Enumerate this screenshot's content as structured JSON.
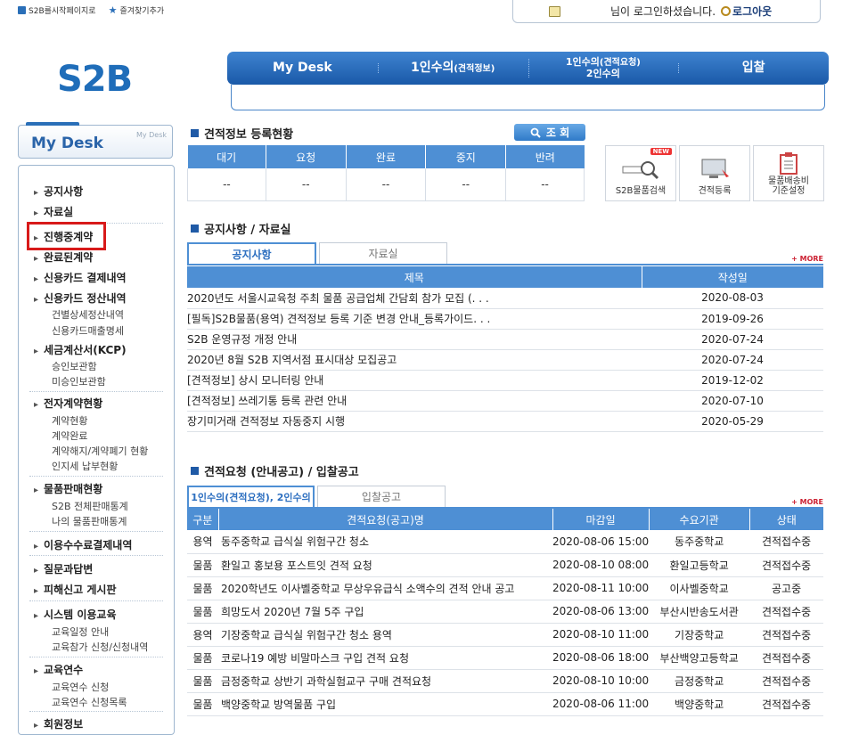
{
  "top": {
    "links": [
      "S2B를시작페이지로",
      "즐겨찾기추가"
    ],
    "login_message": "님이 로그인하셨습니다.",
    "logout": "로그아웃"
  },
  "logo": "S2B",
  "nav": {
    "items": [
      {
        "main": "My Desk",
        "sub": ""
      },
      {
        "main": "1인수의",
        "sub": "(견적정보)"
      },
      {
        "main": "1인수의",
        "sub": "(견적요청)",
        "line2": "2인수의"
      },
      {
        "main": "입찰",
        "sub": ""
      }
    ]
  },
  "sidebar": {
    "title": "My Desk",
    "title_small": "My Desk",
    "groups": [
      {
        "label": "공지사항",
        "subs": []
      },
      {
        "label": "자료실",
        "subs": []
      },
      {
        "label": "진행중계약",
        "subs": []
      },
      {
        "label": "완료된계약",
        "subs": []
      },
      {
        "label": "신용카드 결제내역",
        "subs": []
      },
      {
        "label": "신용카드 정산내역",
        "subs": [
          "건별상세정산내역",
          "신용카드매출명세"
        ]
      },
      {
        "label": "세금계산서(KCP)",
        "subs": [
          "승인보관함",
          "미승인보관함"
        ]
      },
      {
        "label": "전자계약현황",
        "subs": [
          "계약현황",
          "계약완료",
          "계약해지/계약폐기 현황",
          "인지세 납부현황"
        ]
      },
      {
        "label": "물품판매현황",
        "subs": [
          "S2B 전체판매통계",
          "나의 물품판매통계"
        ]
      },
      {
        "label": "이용수수료결제내역",
        "subs": []
      },
      {
        "label": "질문과답변",
        "subs": []
      },
      {
        "label": "피해신고 게시판",
        "subs": []
      },
      {
        "label": "시스템 이용교육",
        "subs": [
          "교육일정 안내",
          "교육참가 신청/신청내역"
        ]
      },
      {
        "label": "교육연수",
        "subs": [
          "교육연수 신청",
          "교육연수 신청목록"
        ]
      },
      {
        "label": "회원정보",
        "subs": []
      }
    ]
  },
  "estimate_status": {
    "title": "견적정보 등록현황",
    "search_button": "조 회",
    "headers": [
      "대기",
      "요청",
      "완료",
      "중지",
      "반려"
    ],
    "values": [
      "--",
      "--",
      "--",
      "--",
      "--"
    ]
  },
  "quick_links": [
    {
      "label": "S2B물품검색",
      "badge": "NEW"
    },
    {
      "label": "견적등록",
      "badge": ""
    },
    {
      "label": "물품배송비\n기준설정",
      "badge": ""
    }
  ],
  "notice": {
    "title": "공지사항 / 자료실",
    "tabs": [
      "공지사항",
      "자료실"
    ],
    "more": "+ MORE",
    "headers": [
      "제목",
      "작성일"
    ],
    "rows": [
      [
        "2020년도 서울시교육청 주최 물품 공급업체 간담회 참가 모집 (. . .",
        "2020-08-03"
      ],
      [
        "[필독]S2B물품(용역) 견적정보 등록 기준 변경 안내_등록가이드. . .",
        "2019-09-26"
      ],
      [
        "S2B 운영규정 개정 안내",
        "2020-07-24"
      ],
      [
        "2020년 8월 S2B 지역서점 표시대상 모집공고",
        "2020-07-24"
      ],
      [
        "[견적정보] 상시 모니터링 안내",
        "2019-12-02"
      ],
      [
        "[견적정보] 쓰레기통 등록 관련 안내",
        "2020-07-10"
      ],
      [
        "장기미거래 견적정보 자동중지 시행",
        "2020-05-29"
      ]
    ]
  },
  "requests": {
    "title": "견적요청 (안내공고) / 입찰공고",
    "tabs": [
      "1인수의(견적요청), 2인수의",
      "입찰공고"
    ],
    "more": "+ MORE",
    "headers": [
      "구분",
      "견적요청(공고)명",
      "마감일",
      "수요기관",
      "상태"
    ],
    "rows": [
      [
        "용역",
        "동주중학교 급식실 위험구간 청소",
        "2020-08-06 15:00",
        "동주중학교",
        "견적접수중"
      ],
      [
        "물품",
        "환일고 홍보용 포스트잇 견적 요청",
        "2020-08-10 08:00",
        "환일고등학교",
        "견적접수중"
      ],
      [
        "물품",
        "2020학년도 이사벨중학교 무상우유급식 소액수의 견적 안내 공고",
        "2020-08-11 10:00",
        "이사벨중학교",
        "공고중"
      ],
      [
        "물품",
        "희망도서 2020년 7월 5주 구입",
        "2020-08-06 13:00",
        "부산시반송도서관",
        "견적접수중"
      ],
      [
        "용역",
        "기장중학교 급식실 위험구간 청소 용역",
        "2020-08-10 11:00",
        "기장중학교",
        "견적접수중"
      ],
      [
        "물품",
        "코로나19 예방 비말마스크 구입 견적 요청",
        "2020-08-06 18:00",
        "부산백양고등학교",
        "견적접수중"
      ],
      [
        "물품",
        "금정중학교 상반기 과학실험교구 구매 견적요청",
        "2020-08-10 10:00",
        "금정중학교",
        "견적접수중"
      ],
      [
        "물품",
        "백양중학교 방역물품 구입",
        "2020-08-06 11:00",
        "백양중학교",
        "견적접수중"
      ]
    ]
  }
}
